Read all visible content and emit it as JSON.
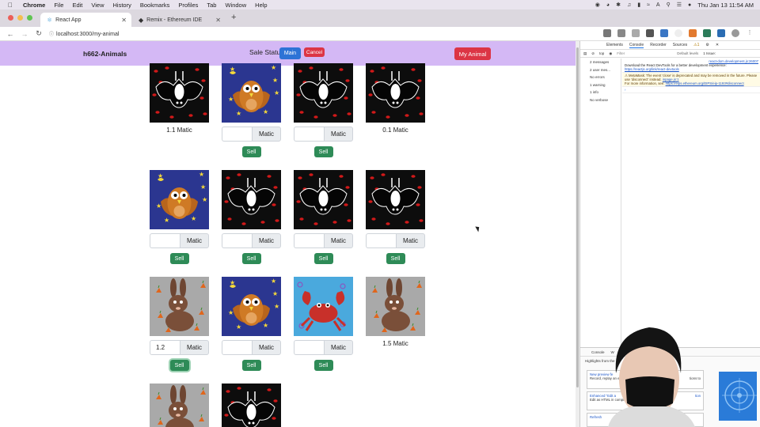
{
  "menubar": {
    "app": "Chrome",
    "items": [
      "File",
      "Edit",
      "View",
      "History",
      "Bookmarks",
      "Profiles",
      "Tab",
      "Window",
      "Help"
    ],
    "datetime": "Thu Jan 13  11:54 AM"
  },
  "tabs": [
    {
      "title": "React App",
      "active": true
    },
    {
      "title": "Remix - Ethereum IDE",
      "active": false
    }
  ],
  "url": "localhost:3000/my-animal",
  "app": {
    "brand": "h662-Animals",
    "sale_status": "Sale Status",
    "main_button": "Main",
    "cancel_button": "Cancel",
    "my_animal_button": "My Animal",
    "unit": "Matic",
    "sell": "Sell",
    "cards": [
      {
        "animal": "bat",
        "state": "listed",
        "price": "1.1 Matic"
      },
      {
        "animal": "owl",
        "state": "input",
        "value": ""
      },
      {
        "animal": "bat",
        "state": "input",
        "value": ""
      },
      {
        "animal": "bat",
        "state": "listed",
        "price": "0.1 Matic"
      },
      {
        "animal": "owl",
        "state": "input",
        "value": ""
      },
      {
        "animal": "bat",
        "state": "input",
        "value": ""
      },
      {
        "animal": "bat",
        "state": "input",
        "value": ""
      },
      {
        "animal": "bat",
        "state": "input",
        "value": ""
      },
      {
        "animal": "rabbit",
        "state": "input",
        "value": "1.2",
        "focused": true
      },
      {
        "animal": "owl",
        "state": "input",
        "value": ""
      },
      {
        "animal": "crab",
        "state": "input",
        "value": ""
      },
      {
        "animal": "rabbit",
        "state": "listed",
        "price": "1.5 Matic"
      },
      {
        "animal": "rabbit",
        "state": "partial"
      },
      {
        "animal": "bat",
        "state": "partial"
      }
    ]
  },
  "devtools": {
    "tabs": [
      "Elements",
      "Console",
      "Recorder",
      "Sources"
    ],
    "filter": "Filter",
    "levels": "Default levels",
    "issues": "1 Issue:",
    "top": "top",
    "sidebar": [
      "2 messages",
      "2 user mes...",
      "No errors",
      "1 warning",
      "1 info",
      "No verbose"
    ],
    "console": {
      "source": "react-dom.development.js:26007",
      "line1": "Download the React DevTools for a better development experience:",
      "link1": "https://reactjs.org/link/react-devtools",
      "warn": "MetaMask: The event 'close' is deprecated and may be removed in the future. Please use 'disconnect' instead.",
      "warn_src": "inpage.js:1",
      "warn_more": "For more information, see:",
      "link2": "https://eips.ethereum.org/EIPS/eip-1193#disconnect"
    },
    "drawer_tabs": [
      "Console",
      "W"
    ],
    "drawer_heading": "Highlights from the",
    "box1_title": "New preview fe",
    "box1_text": "Record, replay an export to Puppete",
    "box1_text_right": "tions to",
    "box2_title": "Enhanced \"Edit a",
    "box2_title_right": "tion",
    "box2_text": "Edit as HTML in completion, synt",
    "box3_title": "Refresh"
  }
}
